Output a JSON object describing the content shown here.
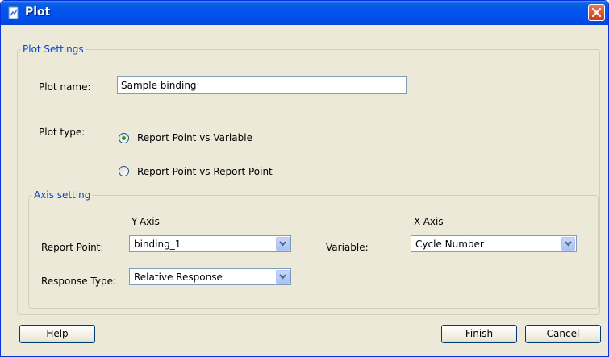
{
  "window": {
    "title": "Plot"
  },
  "plot_settings": {
    "legend": "Plot Settings",
    "plot_name_label": "Plot name:",
    "plot_name_value": "Sample binding",
    "plot_type_label": "Plot type:",
    "plot_type_options": [
      {
        "label": "Report Point vs Variable",
        "selected": true
      },
      {
        "label": "Report Point vs Report Point",
        "selected": false
      }
    ]
  },
  "axis_setting": {
    "legend": "Axis setting",
    "y_axis_header": "Y-Axis",
    "x_axis_header": "X-Axis",
    "report_point_label": "Report Point:",
    "report_point_value": "binding_1",
    "response_type_label": "Response Type:",
    "response_type_value": "Relative Response",
    "variable_label": "Variable:",
    "variable_value": "Cycle Number"
  },
  "buttons": {
    "help": "Help",
    "finish": "Finish",
    "cancel": "Cancel"
  },
  "colors": {
    "title_bar": "#0053ee",
    "legend_text": "#0046d5",
    "dialog_bg": "#ece9d8",
    "radio_selected": "#21a121"
  }
}
